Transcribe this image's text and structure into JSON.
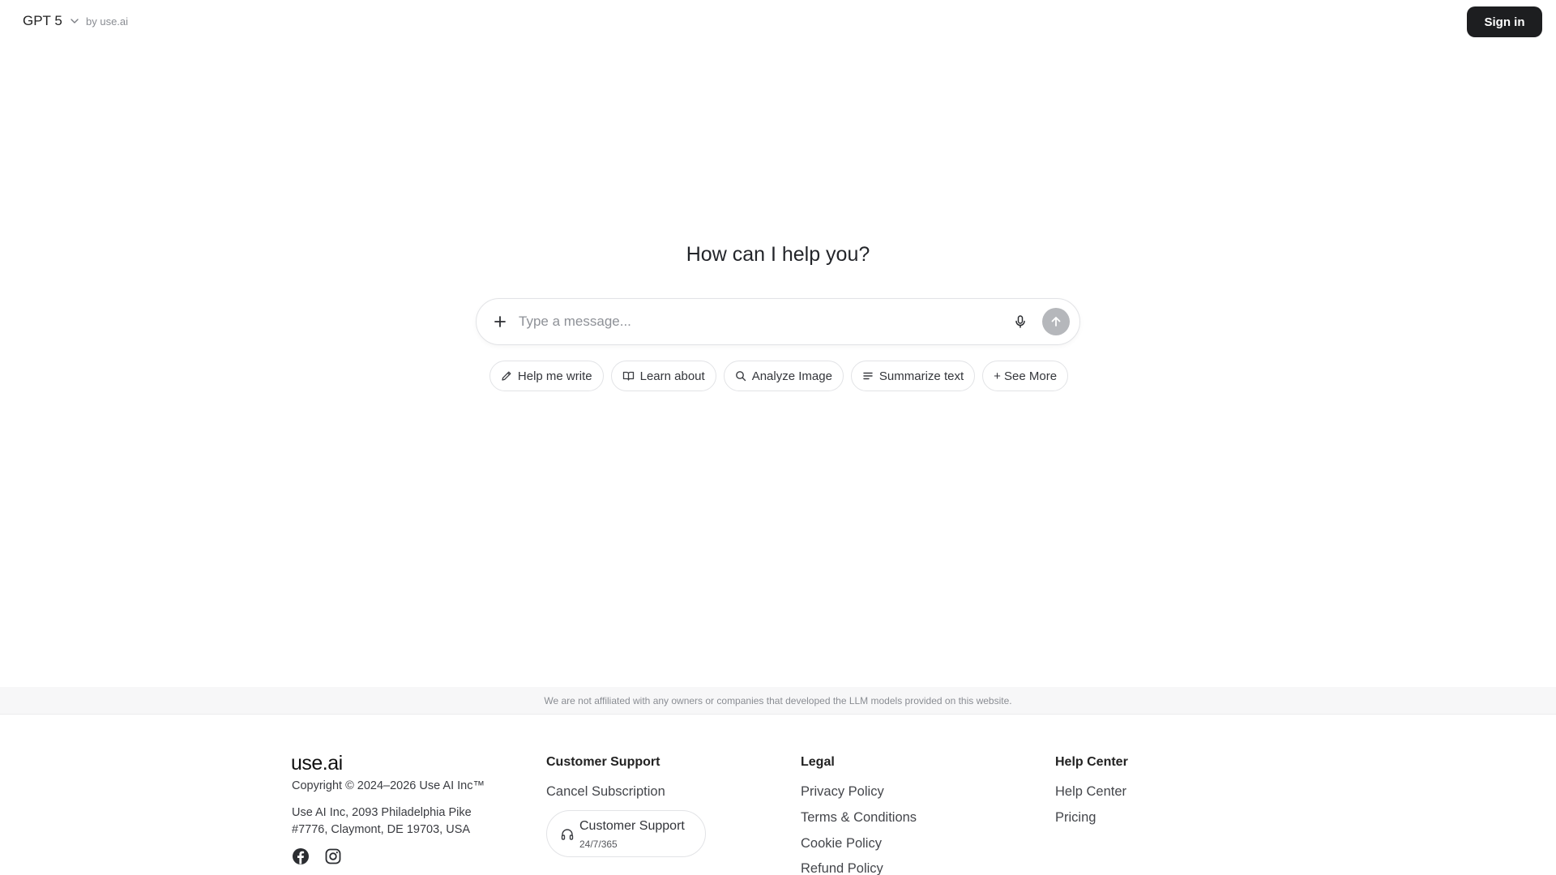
{
  "header": {
    "model_name": "GPT 5",
    "byline": "by use.ai",
    "signin_label": "Sign in"
  },
  "main": {
    "headline": "How can I help you?",
    "composer": {
      "placeholder": "Type a message...",
      "value": ""
    },
    "chips": [
      {
        "label": "Help me write",
        "icon": "pencil-icon"
      },
      {
        "label": "Learn about",
        "icon": "book-icon"
      },
      {
        "label": "Analyze Image",
        "icon": "search-icon"
      },
      {
        "label": "Summarize text",
        "icon": "lines-icon"
      },
      {
        "label": "+ See More",
        "icon": ""
      }
    ]
  },
  "disclaimer": "We are not affiliated with any owners or companies that developed the LLM models provided on this website.",
  "footer": {
    "brand": "use.ai",
    "copyright": "Copyright © 2024–2026 Use AI Inc™",
    "address_line1": "Use AI Inc, 2093 Philadelphia Pike",
    "address_line2": "#7776, Claymont, DE 19703, USA",
    "customer_support": {
      "title": "Customer Support",
      "links": [
        "Cancel Subscription"
      ],
      "card_title": "Customer Support",
      "card_subtitle": "24/7/365"
    },
    "legal": {
      "title": "Legal",
      "links": [
        "Privacy Policy",
        "Terms & Conditions",
        "Cookie Policy",
        "Refund Policy"
      ]
    },
    "help_center": {
      "title": "Help Center",
      "links": [
        "Help Center",
        "Pricing"
      ]
    }
  },
  "colors": {
    "primary_button": "#1d1e20",
    "send_button_disabled": "#b5b7bb",
    "border": "#e2e3e6"
  }
}
